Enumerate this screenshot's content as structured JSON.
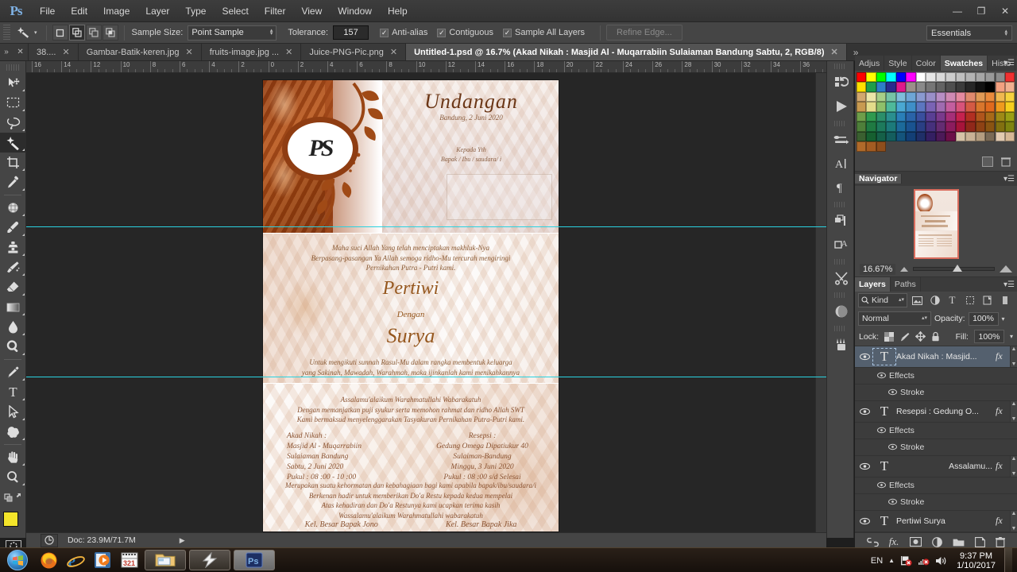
{
  "app": {
    "name": "Ps",
    "workspace": "Essentials"
  },
  "menubar": {
    "items": [
      "File",
      "Edit",
      "Image",
      "Layer",
      "Type",
      "Select",
      "Filter",
      "View",
      "Window",
      "Help"
    ]
  },
  "window_controls": {
    "minimize": "—",
    "restore": "❐",
    "close": "✕"
  },
  "options_bar": {
    "tool_icon": "magic-wand-icon",
    "selection_modes": [
      "new-selection",
      "add-to-selection",
      "subtract-from-selection",
      "intersect-with-selection"
    ],
    "sample_size_label": "Sample Size:",
    "sample_size_value": "Point Sample",
    "tolerance_label": "Tolerance:",
    "tolerance_value": "157",
    "checkboxes": [
      {
        "label": "Anti-alias",
        "checked": true
      },
      {
        "label": "Contiguous",
        "checked": true
      },
      {
        "label": "Sample All Layers",
        "checked": true
      }
    ],
    "refine_edge_label": "Refine Edge..."
  },
  "document_tabs": [
    {
      "label": "38....",
      "active": false
    },
    {
      "label": "Gambar-Batik-keren.jpg",
      "active": false
    },
    {
      "label": "fruits-image.jpg ...",
      "active": false
    },
    {
      "label": "Juice-PNG-Pic.png",
      "active": false
    },
    {
      "label": "Untitled-1.psd @ 16.7% (Akad Nikah : Masjid Al - Muqarrabiin Sulaiaman Bandung Sabtu, 2, RGB/8)",
      "active": true
    }
  ],
  "tab_overflow": "»",
  "toolbox": {
    "tools": [
      {
        "name": "move-tool",
        "selected": false
      },
      {
        "name": "rectangular-marquee-tool",
        "selected": false
      },
      {
        "name": "lasso-tool",
        "selected": false
      },
      {
        "name": "magic-wand-tool",
        "selected": true
      },
      {
        "name": "crop-tool",
        "selected": false
      },
      {
        "name": "eyedropper-tool",
        "selected": false
      },
      {
        "name": "spot-healing-brush-tool",
        "selected": false
      },
      {
        "name": "brush-tool",
        "selected": false
      },
      {
        "name": "clone-stamp-tool",
        "selected": false
      },
      {
        "name": "history-brush-tool",
        "selected": false
      },
      {
        "name": "eraser-tool",
        "selected": false
      },
      {
        "name": "gradient-tool",
        "selected": false
      },
      {
        "name": "blur-tool",
        "selected": false
      },
      {
        "name": "dodge-tool",
        "selected": false
      },
      {
        "name": "pen-tool",
        "selected": false
      },
      {
        "name": "horizontal-type-tool",
        "selected": false
      },
      {
        "name": "path-selection-tool",
        "selected": false
      },
      {
        "name": "custom-shape-tool",
        "selected": false
      },
      {
        "name": "hand-tool",
        "selected": false
      },
      {
        "name": "zoom-tool",
        "selected": false
      }
    ],
    "foreground_color": "#f4e52a",
    "background_color": "#f0a884"
  },
  "ruler": {
    "horizontal_ticks": [
      "16",
      "14",
      "12",
      "10",
      "8",
      "6",
      "4",
      "2",
      "0",
      "2",
      "4",
      "6",
      "8",
      "10",
      "12",
      "14",
      "16",
      "18",
      "20",
      "22",
      "24",
      "26",
      "28",
      "30",
      "32",
      "34",
      "36"
    ]
  },
  "canvas": {
    "guides": 2,
    "card": {
      "section_top": {
        "monogram": "PS",
        "title": "Undangan",
        "date_line": "Bandung, 2 Juni 2020",
        "kepada_line1": "Kepada Yth",
        "kepada_line2": "Bapak / Ibu / saudara/ i"
      },
      "section_middle": {
        "intro": "Maha suci Allah Yang telah menciptakan makhluk-Nya\nBerpasang-pasangan Ya Allah semoga ridho-Mu tercurah mengiringi\nPernikahan Putra - Putri kami.",
        "bride": "Pertiwi",
        "connector": "Dengan",
        "groom": "Surya",
        "outro": "Untuk mengikuti sunnah Rasul-Mu dalam rangka membentuk keluarga\nyang Sakinah, Mawadah, Warahmah, maka ijinkanlah kami menikahkannya"
      },
      "section_bottom": {
        "greeting": "Assalamu'alaikum Warahmatullahi Wabarakatuh\nDengan memanjatkan puji syukur serta memohon rahmat dan ridho Allah SWT\nKami bermaksud menyelenggarakan Tasyakuran Pernikahan Putra-Putri kami.",
        "event_left": "Akad Nikah :\nMasjid Al - Muqarrabiin\nSulaiaman Bandung\nSabtu, 2 Juni 2020\nPukul : 08 :00 - 10 :00",
        "event_right": "Resepsi :\nGedung Omega Dipatiukur 40\nSulaiman-Bandung\nMinggu, 3 Juni 2020\nPukul : 08 :00 s/d Selesai",
        "closing": "Merupakan suatu kehormatan dan kebahagiaan bagi kami apabila bapak/ibu/saudara/i\nBerkenan hadir untuk memberikan Do'a Restu kepada kedua mempelai\nAtas kehadiran dan Do'a Restunya kami ucapkan terima kasih\nWassalamu'alaikum Warahmatullahi wabarakatuh",
        "family_left": "Kel. Besar Bapak Jono",
        "family_right": "Kel. Besar Bapak Jika"
      }
    }
  },
  "right_dock": {
    "icons": [
      "history-icon",
      "actions-play-icon",
      "brush-presets-icon",
      "character-icon",
      "paragraph-icon",
      "layer-comps-icon",
      "styles-icon",
      "tool-presets-icon",
      "3d-icon",
      "clone-source-icon"
    ]
  },
  "panels": {
    "swatch_group_tabs": [
      {
        "label": "Adjus",
        "active": false
      },
      {
        "label": "Style",
        "active": false
      },
      {
        "label": "Color",
        "active": false
      },
      {
        "label": "Swatches",
        "active": true
      },
      {
        "label": "Histo",
        "active": false
      }
    ],
    "navigator": {
      "title": "Navigator",
      "zoom_value": "16.67%"
    },
    "layers": {
      "tabs": [
        {
          "label": "Layers",
          "active": true
        },
        {
          "label": "Paths",
          "active": false
        }
      ],
      "filter_kind_label": "Kind",
      "blend_mode": "Normal",
      "opacity_label": "Opacity:",
      "opacity_value": "100%",
      "lock_label": "Lock:",
      "fill_label": "Fill:",
      "fill_value": "100%",
      "items": [
        {
          "name": "Akad Nikah : Masjid...",
          "selected": true,
          "fx": "fx",
          "align": "left",
          "children": [
            "Effects",
            "Stroke"
          ]
        },
        {
          "name": "Resepsi : Gedung O...",
          "selected": false,
          "fx": "fx",
          "align": "left",
          "children": [
            "Effects",
            "Stroke"
          ]
        },
        {
          "name": "Assalamu...",
          "selected": false,
          "fx": "fx",
          "align": "right",
          "children": [
            "Effects",
            "Stroke"
          ]
        },
        {
          "name": "Pertiwi  Surya",
          "selected": false,
          "fx": "fx",
          "align": "left",
          "children": []
        }
      ],
      "footer_icons": [
        "link-layers-icon",
        "add-layer-style-icon",
        "add-layer-mask-icon",
        "new-adjustment-layer-icon",
        "new-group-icon",
        "new-layer-icon",
        "delete-layer-icon"
      ]
    }
  },
  "status_bar": {
    "doc_info": "Doc: 23.9M/71.7M"
  },
  "taskbar": {
    "start": "start-orb-icon",
    "quick_launch": [
      "firefox-icon",
      "internet-explorer-icon",
      "media-player-icon",
      "klite-321-icon"
    ],
    "windows": [
      {
        "name": "explorer-window",
        "active": false
      },
      {
        "name": "winamp-window",
        "active": false
      },
      {
        "name": "photoshop-window",
        "active": true
      }
    ],
    "tray": {
      "language": "EN",
      "show_hidden": "▲",
      "icons": [
        "network-error-icon",
        "volume-muted-icon",
        "speaker-icon"
      ],
      "time": "9:37 PM",
      "date": "1/10/2017"
    }
  },
  "swatch_colors": [
    "#ff0000",
    "#ffff00",
    "#00ff00",
    "#00ffff",
    "#0000ff",
    "#ff00ff",
    "#ffffff",
    "#e6e6e6",
    "#d9d9d9",
    "#cccccc",
    "#bfbfbf",
    "#b3b3b3",
    "#a6a6a6",
    "#999999",
    "#8c8c8c",
    "#f03030",
    "#ffe000",
    "#1e9e4a",
    "#2e7ec8",
    "#2a2a8e",
    "#e0188c",
    "#9b8f8a",
    "#8a8a8a",
    "#767676",
    "#636363",
    "#4f4f4f",
    "#3b3b3b",
    "#262626",
    "#111111",
    "#000000",
    "#f2a080",
    "#f0b090",
    "#d2a86e",
    "#ece6a8",
    "#a8cf88",
    "#76c4a6",
    "#7fbddb",
    "#6ea6d6",
    "#8a9ad0",
    "#9a8fc8",
    "#b88ec4",
    "#d08ab4",
    "#e58aa0",
    "#e08a6e",
    "#e09a56",
    "#ea8a3c",
    "#f0b850",
    "#f5d23e",
    "#c89a50",
    "#e3dc8a",
    "#8ec06a",
    "#4eb99a",
    "#4aa8d2",
    "#3f8fc8",
    "#5c76c0",
    "#7a63b4",
    "#a06bb0",
    "#c45e9e",
    "#d8537a",
    "#d45a44",
    "#d9762c",
    "#e06a1e",
    "#ef9b1e",
    "#f5cf1e",
    "#6e9e4a",
    "#2f9a4f",
    "#2b8f6a",
    "#2a8f8f",
    "#2a7fb8",
    "#2a63a8",
    "#3a4f9e",
    "#5a3f94",
    "#7a3a8c",
    "#a62f78",
    "#c6224e",
    "#b22f22",
    "#b0551c",
    "#a86a18",
    "#9e8a16",
    "#9aa015",
    "#4e7f3a",
    "#1f7a42",
    "#1d7a5c",
    "#1c7a7a",
    "#1c6a9a",
    "#1a5390",
    "#2a3f84",
    "#46307c",
    "#642c72",
    "#8c1c5e",
    "#a6143a",
    "#90281a",
    "#8e4214",
    "#8a5412",
    "#827010",
    "#7e8410",
    "#3a6030",
    "#166030",
    "#156048",
    "#145e5e",
    "#14547c",
    "#133f76",
    "#1f2f68",
    "#341f62",
    "#4c1a58",
    "#6c1048",
    "#d6c3a8",
    "#c9b296",
    "#b49d80",
    "#7a6a56",
    "#e2cbb2",
    "#d6b896",
    "#b06a2a",
    "#a35c22",
    "#8e4e1c",
    "",
    "",
    "",
    "",
    "",
    "",
    "",
    "",
    "",
    "",
    "",
    "",
    ""
  ]
}
